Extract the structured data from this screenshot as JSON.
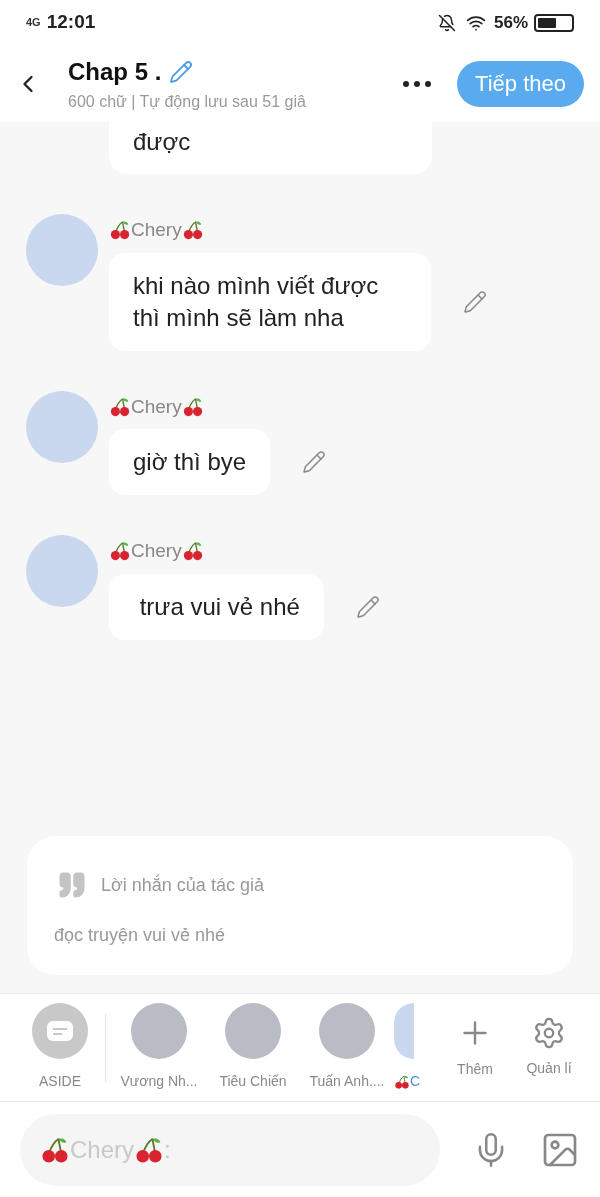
{
  "status_bar": {
    "network": "4G",
    "time": "12:01",
    "battery": "56%"
  },
  "header": {
    "title": "Chap 5 .",
    "subtitle": "600 chữ | Tự động lưu sau 51 giâ",
    "next_button": "Tiếp theo"
  },
  "messages": [
    {
      "kind": "partial",
      "text": "được"
    },
    {
      "kind": "message",
      "name": "Chery",
      "text": "khi nào mình viết được thì mình sẽ làm nha"
    },
    {
      "kind": "message",
      "name": "Chery",
      "text": "giờ thì bye"
    },
    {
      "kind": "message",
      "name": "Chery",
      "text": " trưa vui vẻ nhé"
    }
  ],
  "author_note": {
    "title": "Lời nhắn của tác giả",
    "body": "đọc truyện vui vẻ nhé"
  },
  "characters": [
    {
      "kind": "aside",
      "label": "ASIDE"
    },
    {
      "kind": "avatar",
      "label": "Vương Nh..."
    },
    {
      "kind": "avatar",
      "label": "Tiêu Chiến"
    },
    {
      "kind": "avatar",
      "label": "Tuấn Anh...."
    },
    {
      "kind": "cut",
      "label": "C"
    }
  ],
  "tools": [
    {
      "kind": "add",
      "label": "Thêm"
    },
    {
      "kind": "manage",
      "label": "Quản lí"
    }
  ],
  "input": {
    "name": "Chery",
    "suffix": ":"
  }
}
